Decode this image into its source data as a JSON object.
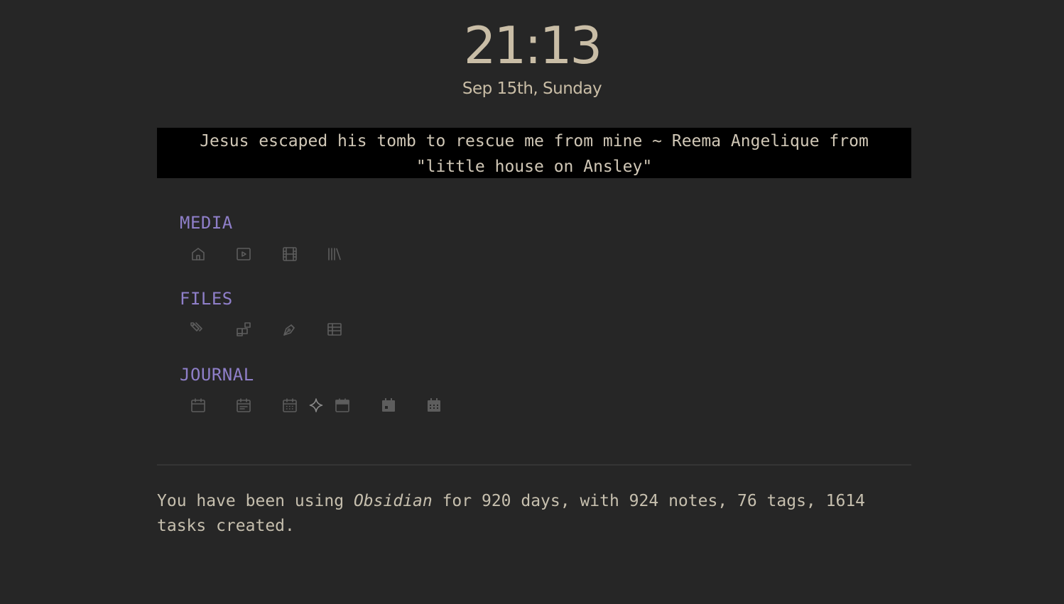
{
  "clock": {
    "time": "21:13",
    "date": "Sep 15th, Sunday"
  },
  "quote": {
    "text": "Jesus escaped his tomb to rescue me from mine ~ Reema Angelique from \"little house on Ansley\""
  },
  "sections": {
    "media": {
      "title": "MEDIA",
      "icons": [
        "home-icon",
        "play-square-icon",
        "film-icon",
        "library-icon"
      ]
    },
    "files": {
      "title": "FILES",
      "icons": [
        "tags-icon",
        "blocks-icon",
        "pen-tool-icon",
        "table-icon"
      ]
    },
    "journal": {
      "title": "JOURNAL",
      "icons": [
        "calendar-icon",
        "calendar-lines-icon",
        "calendar-grid-icon",
        "sparkle-icon",
        "calendar-filled-icon",
        "calendar-event-filled-icon",
        "calendar-grid-filled-icon"
      ]
    }
  },
  "stats": {
    "prefix": "You have been using ",
    "app": "Obsidian",
    "suffix": " for 920 days, with 924 notes, 76 tags, 1614 tasks created."
  },
  "colors": {
    "background": "#262626",
    "accent": "#8f7fc9",
    "clock": "#c9bda6",
    "quote_bg": "#000000",
    "icon": "#5d5d5d"
  }
}
